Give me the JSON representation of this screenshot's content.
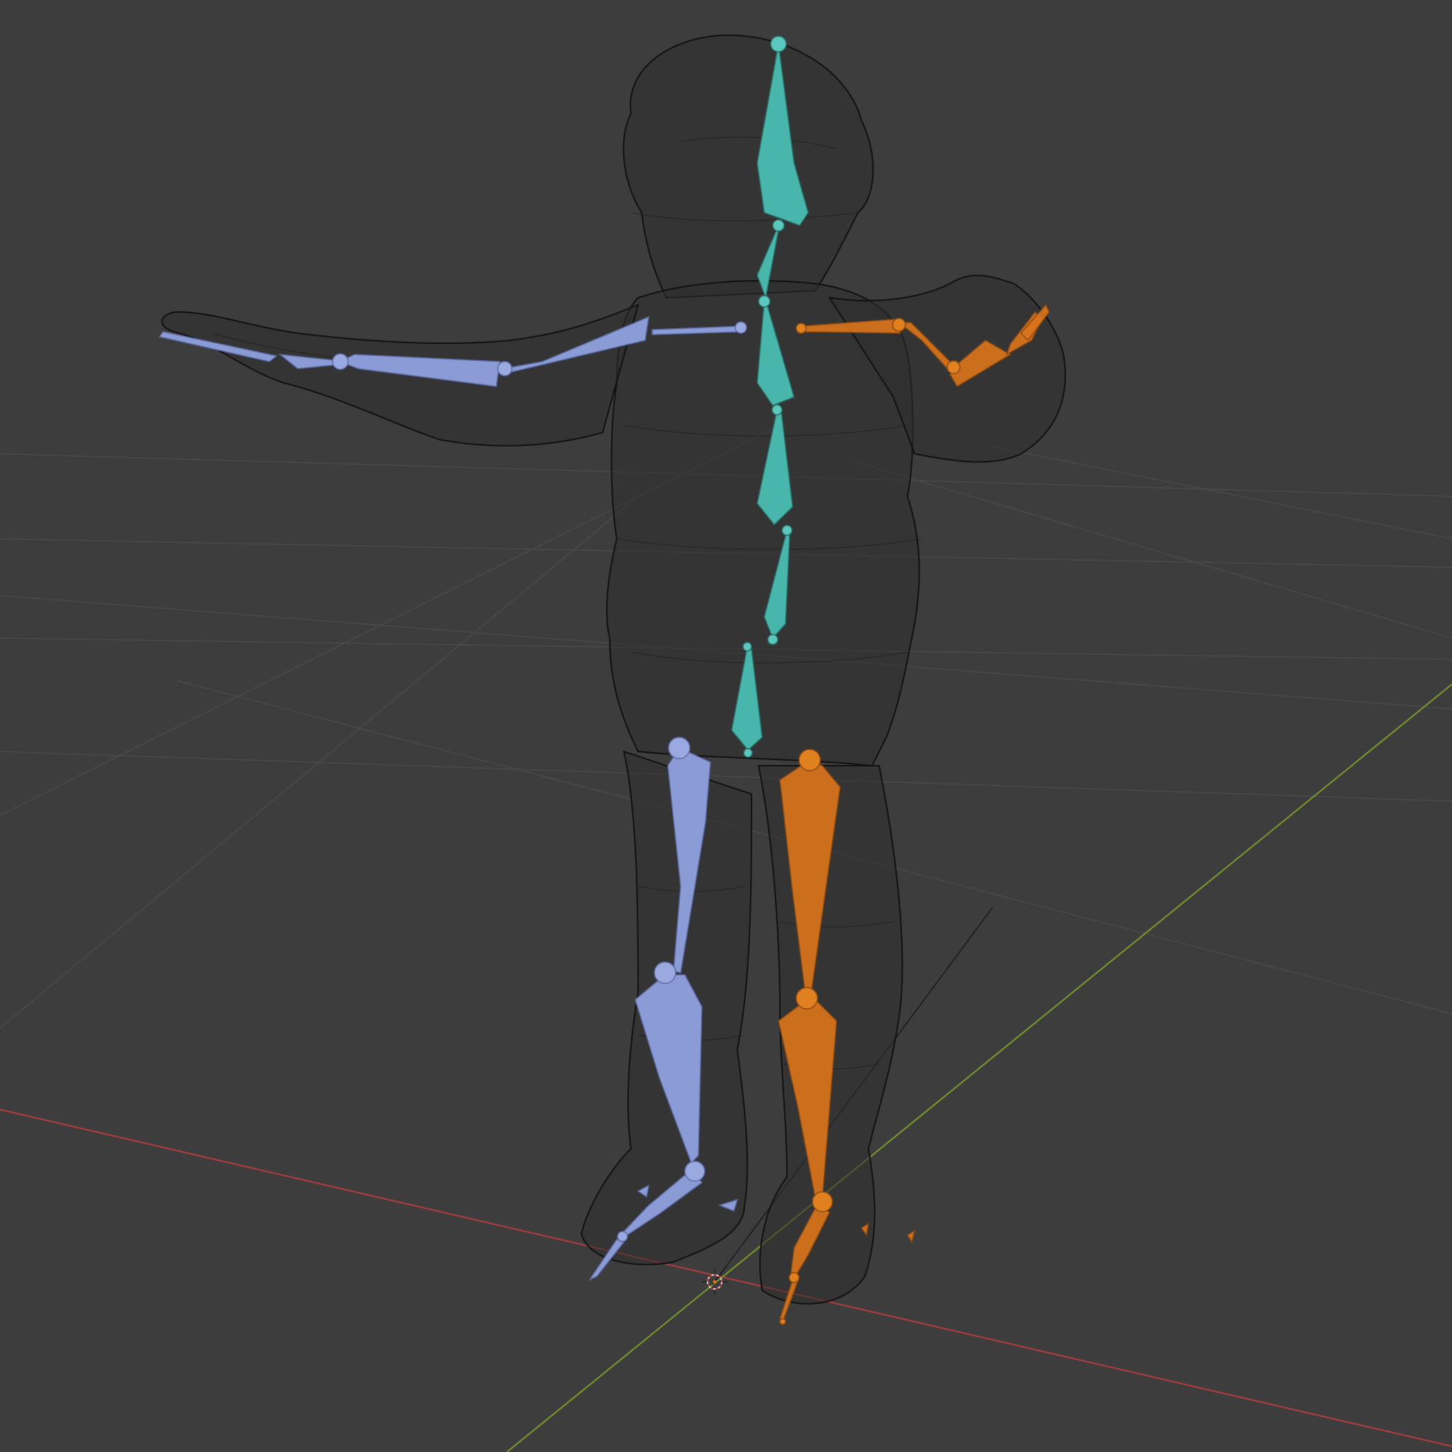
{
  "viewport": {
    "background": "#3d3d3d",
    "grid_color": "#4a4a4a",
    "x_axis_color": "#b33c3c",
    "y_axis_color": "#7a9a2a",
    "shading": "wireframe"
  },
  "armature": {
    "colors": {
      "center": "#49b6ab",
      "right_side": "#8a9bd6",
      "left_side_selected": "#d9741c"
    }
  },
  "icons": [
    "3d-cursor-icon"
  ]
}
